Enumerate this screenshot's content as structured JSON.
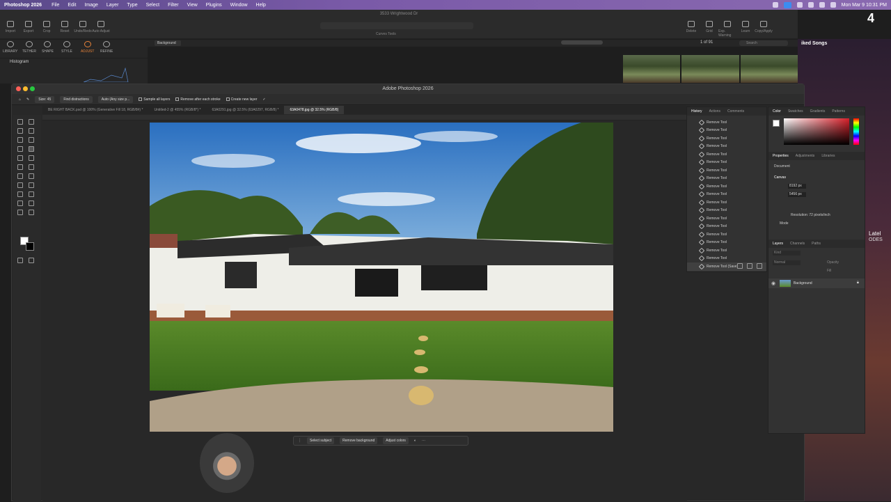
{
  "menubar": {
    "apple": "",
    "app": "Photoshop 2026",
    "items": [
      "File",
      "Edit",
      "Image",
      "Layer",
      "Type",
      "Select",
      "Filter",
      "View",
      "Plugins",
      "Window",
      "Help"
    ],
    "clock": "Mon Mar 9  10:31 PM"
  },
  "lightroom": {
    "doc_title": "3533 Wrightwood Dr",
    "top_tools": [
      "Import",
      "Export",
      "Crop",
      "Reset",
      "Undo/Redo",
      "Auto Adjust"
    ],
    "center_tools_label": "Curves Tools",
    "right_tools": [
      "Delete",
      "Grid",
      "Exp. Warning",
      "Learn",
      "Copy/Apply"
    ],
    "modules": [
      "LIBRARY",
      "TETHER",
      "SHAPE",
      "STYLE",
      "ADJUST",
      "REFINE"
    ],
    "active_module": "ADJUST",
    "layer_select": "Background",
    "histogram_label": "Histogram",
    "counter": "1 of 91",
    "search_placeholder": "Search",
    "overlay_right": "iked Songs",
    "right_text_1": "Latel",
    "right_text_2": "ODES"
  },
  "photoshop": {
    "window_title": "Adobe Photoshop 2026",
    "options": {
      "size_label": "Size: 45",
      "find_distractions": "Find distractions",
      "auto_mode": "Auto (Any size p...",
      "sample_all_layers": "Sample all layers",
      "remove_after_stroke": "Remove after each stroke",
      "create_new_layer": "Create new layer"
    },
    "tabs": [
      "BE RIGHT BACK.psd @ 100% (Generative Fill 18, RGB/8#) *",
      "Untitled-2 @ 455% (RGB/8*) *",
      "63A0291.jpg @ 32.5% (63A0297, RGB/8) *",
      "63A0478.jpg @ 32.5% (RGB/8)"
    ],
    "active_tab": 3,
    "history": {
      "tabs": [
        "History",
        "Actions",
        "Comments"
      ],
      "items": [
        "Remove Tool",
        "Remove Tool",
        "Remove Tool",
        "Remove Tool",
        "Remove Tool",
        "Remove Tool",
        "Remove Tool",
        "Remove Tool",
        "Remove Tool",
        "Remove Tool",
        "Remove Tool",
        "Remove Tool",
        "Remove Tool",
        "Remove Tool",
        "Remove Tool",
        "Remove Tool",
        "Remove Tool",
        "Remove Tool"
      ],
      "selected_item": "Remove Tool (Save)"
    },
    "color": {
      "tabs": [
        "Color",
        "Swatches",
        "Gradients",
        "Patterns"
      ],
      "accent": "#d8202a"
    },
    "properties": {
      "tabs": [
        "Properties",
        "Adjustments",
        "Libraries"
      ],
      "doc": "Document",
      "section": "Canvas",
      "w": "8192 px",
      "h": "5456 px",
      "resolution": "Resolution: 72 pixels/inch",
      "mode": "Mode"
    },
    "layers": {
      "tabs": [
        "Layers",
        "Channels",
        "Paths"
      ],
      "kind": "Kind",
      "blend": "Normal",
      "opacity": "Opacity",
      "fill": "Fill",
      "layer_name": "Background"
    },
    "contextbar": {
      "select_subject": "Select subject",
      "remove_background": "Remove background",
      "adjust_colors": "Adjust colors"
    }
  }
}
